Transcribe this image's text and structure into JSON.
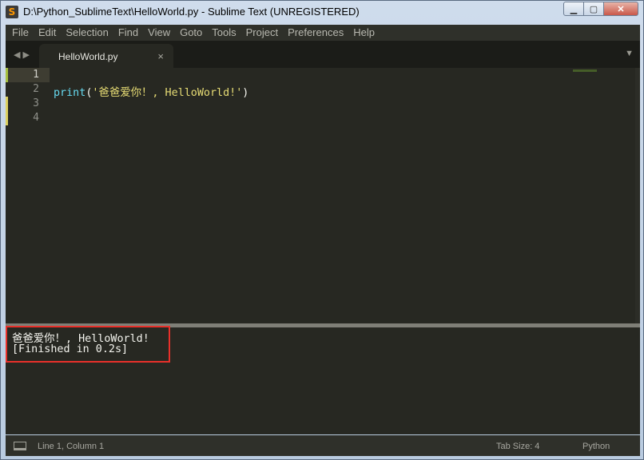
{
  "window": {
    "title": "D:\\Python_SublimeText\\HelloWorld.py - Sublime Text (UNREGISTERED)",
    "app_icon": "sublime-text-icon",
    "controls": {
      "minimize": "▁",
      "maximize": "▢",
      "close": "✕"
    }
  },
  "menu": [
    "File",
    "Edit",
    "Selection",
    "Find",
    "View",
    "Goto",
    "Tools",
    "Project",
    "Preferences",
    "Help"
  ],
  "tabbar": {
    "nav": "◀▶",
    "tab_label": "HelloWorld.py",
    "tab_close": "×",
    "dropdown": "▼"
  },
  "editor": {
    "line_numbers": [
      "1",
      "2",
      "3",
      "4"
    ],
    "code": {
      "func": "print",
      "open": "(",
      "string": "'爸爸爱你！, HelloWorld!'",
      "close": ")"
    }
  },
  "output": {
    "lines": [
      "爸爸爱你！, HelloWorld!",
      "[Finished in 0.2s]"
    ]
  },
  "status": {
    "position": "Line 1, Column 1",
    "tab_size": "Tab Size: 4",
    "syntax": "Python"
  },
  "colors": {
    "editor_bg": "#272822",
    "keyword": "#66d9ef",
    "string": "#e6db74",
    "highlight_box": "#e8302a"
  }
}
